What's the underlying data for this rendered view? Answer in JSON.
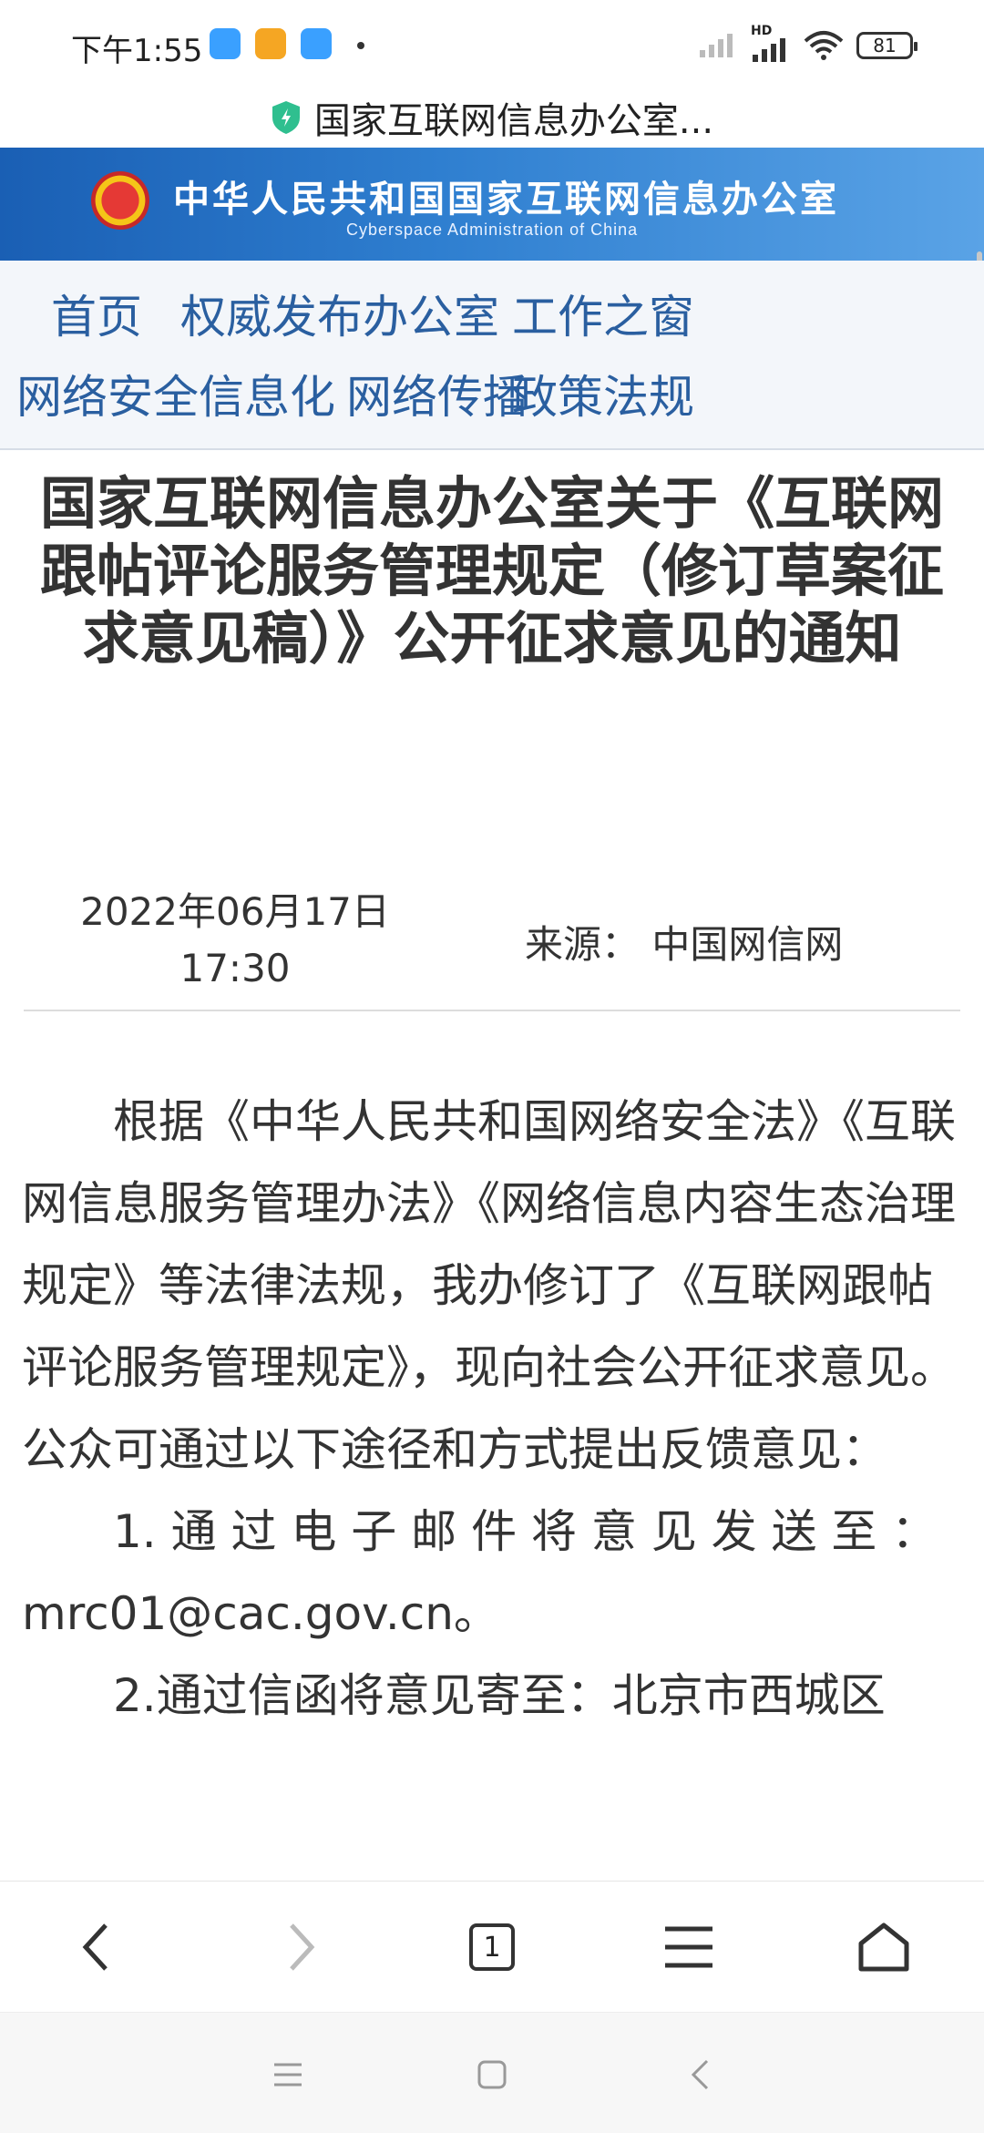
{
  "status_bar": {
    "time": "下午1:55",
    "app_icon_colors": [
      "#3aa0ff",
      "#f5a623",
      "#3aa0ff"
    ],
    "network_label": "HD",
    "battery": "81"
  },
  "url_bar": {
    "shield_icon": "shield-icon",
    "page_title": "国家互联网信息办公室..."
  },
  "banner": {
    "title": "中华人民共和国国家互联网信息办公室",
    "subtitle": "Cyberspace Administration of China"
  },
  "nav": {
    "row1": [
      "首页",
      "权威发布",
      "办公室",
      "工作之窗"
    ],
    "row2": [
      "网络安全",
      "信息化",
      "网络传播",
      "政策法规"
    ]
  },
  "article": {
    "title": "国家互联网信息办公室关于《互联网跟帖评论服务管理规定（修订草案征求意见稿）》公开征求意见的通知",
    "date": "2022年06月17日",
    "time": "17:30",
    "source": "来源：  中国网信网",
    "para1": "根据《中华人民共和国网络安全法》《互联网信息服务管理办法》《网络信息内容生态治理规定》等法律法规，我办修订了《互联网跟帖评论服务管理规定》，现向社会公开征求意见。公众可通过以下途径和方式提出反馈意见：",
    "para2": "1. 通 过 电 子 邮 件 将 意 见 发 送 至 ：mrc01@cac.gov.cn。",
    "para3": "2.通过信函将意见寄至：北京市西城区"
  },
  "toolbar": {
    "tab_count": "1"
  },
  "colors": {
    "banner_start": "#1a5fb4",
    "banner_end": "#5aa3e6",
    "nav_text": "#2a5fa0"
  }
}
